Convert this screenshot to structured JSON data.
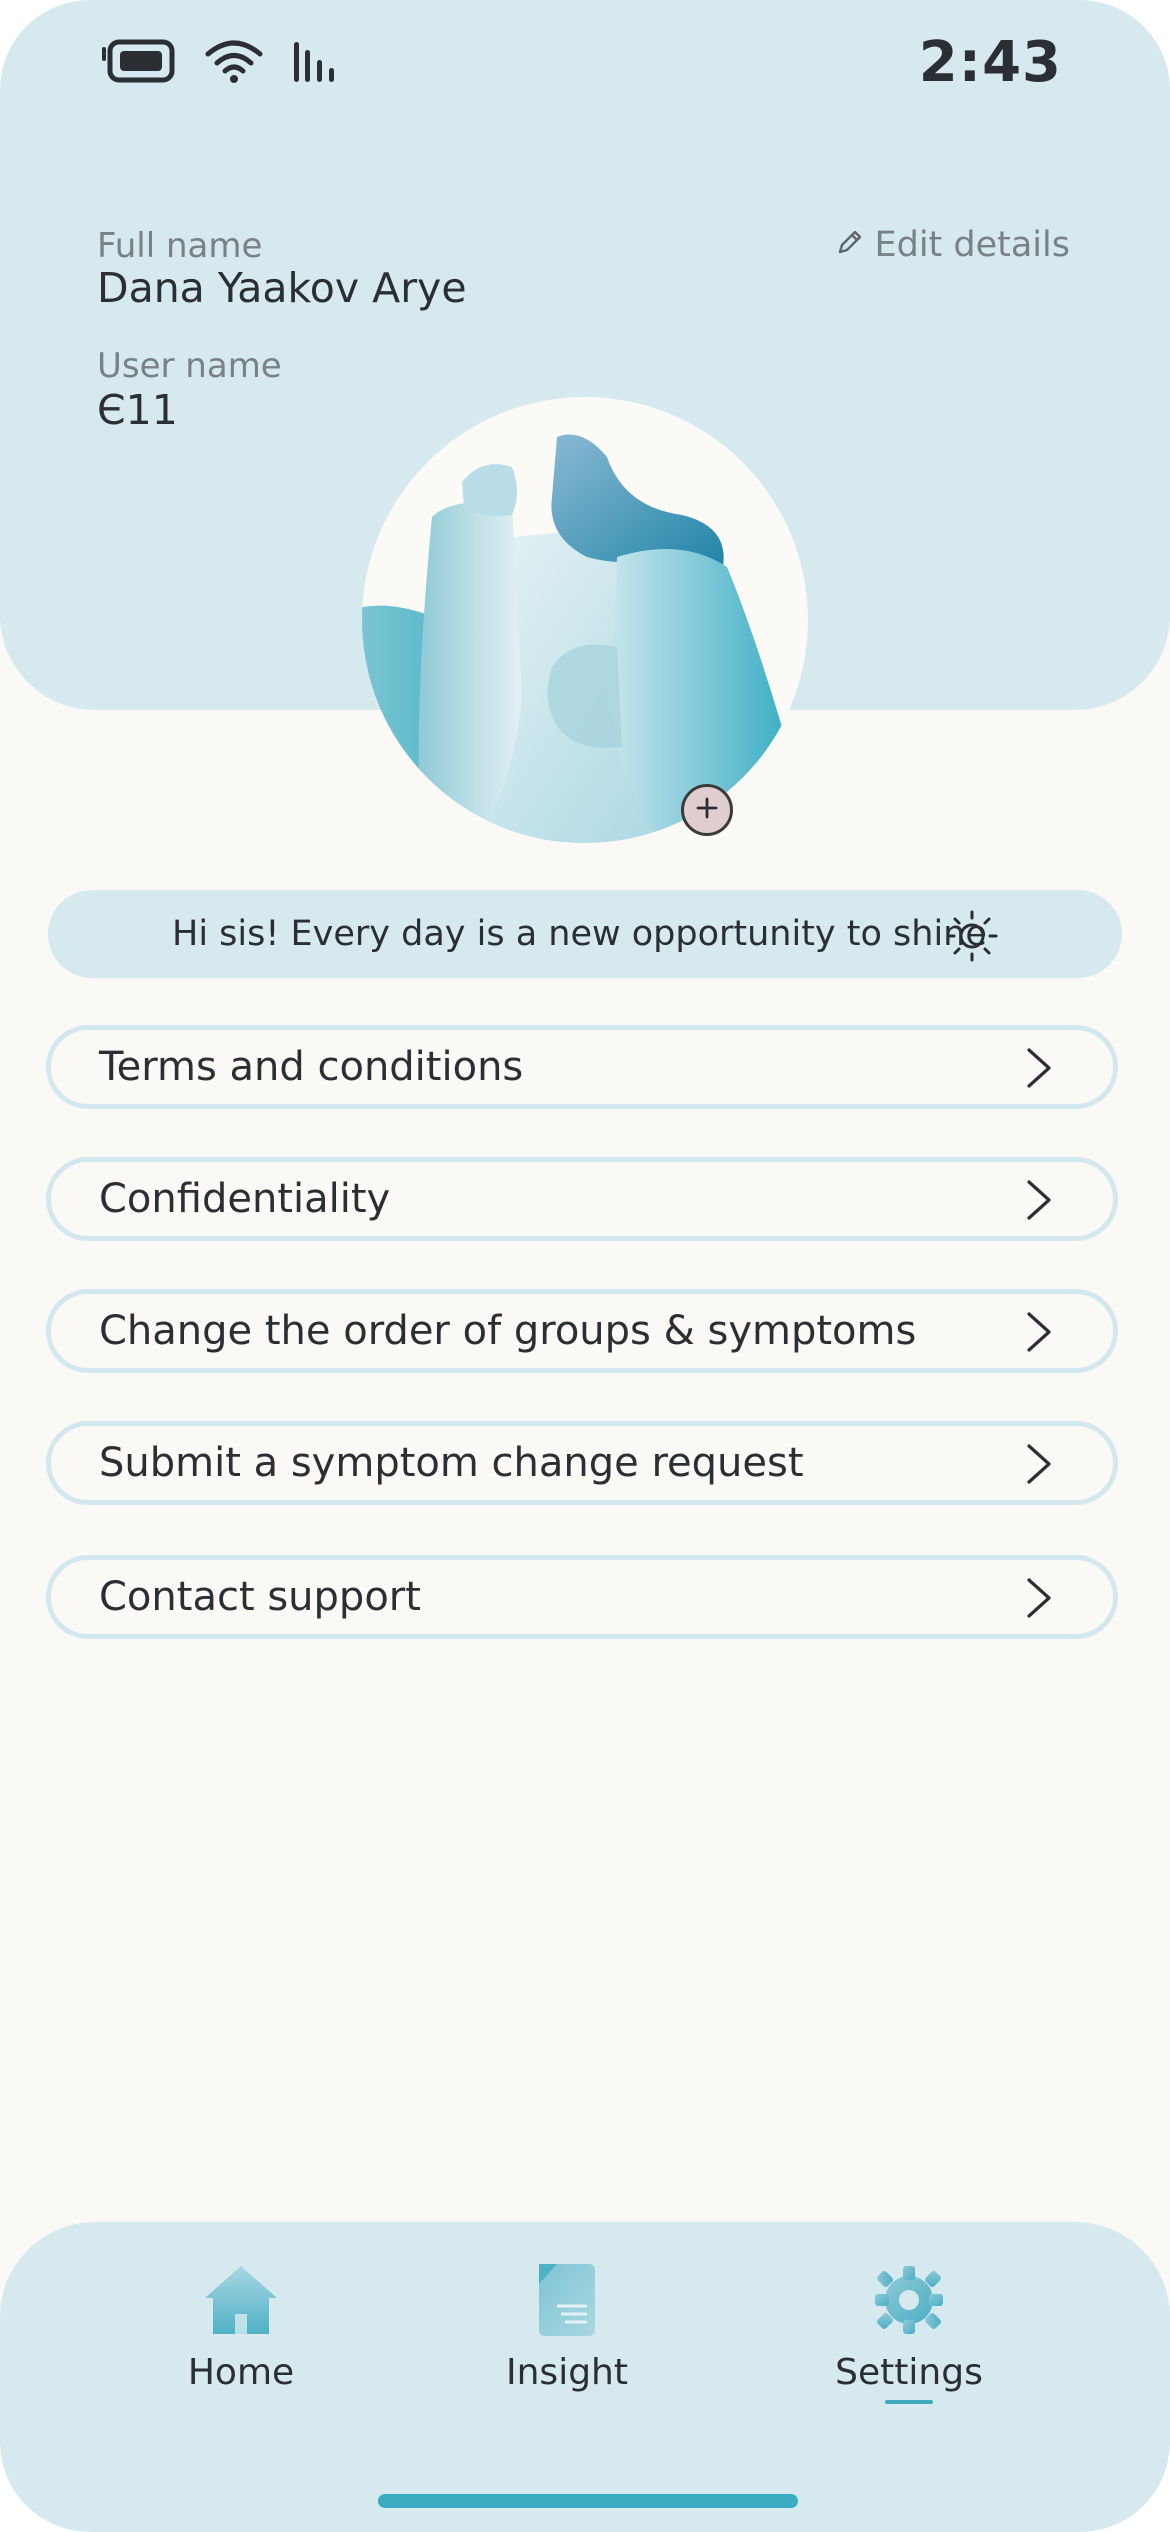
{
  "status_bar": {
    "time": "2:43",
    "icons": [
      "battery-icon",
      "wifi-icon",
      "signal-icon"
    ]
  },
  "profile": {
    "full_name_label": "Full name",
    "full_name": "Dana Yaakov Arye",
    "user_name_label": "User name",
    "user_name": "Є11",
    "edit_label": "Edit details",
    "avatar_add_icon": "plus-icon"
  },
  "greeting": {
    "text": "Hi sis! Every day is a new opportunity to shine",
    "icon": "sun-icon"
  },
  "menu": {
    "items": [
      {
        "label": "Terms and conditions"
      },
      {
        "label": "Confidentiality"
      },
      {
        "label": "Change the order of groups & symptoms"
      },
      {
        "label": "Submit a symptom change request"
      },
      {
        "label": "Contact support"
      }
    ]
  },
  "nav": {
    "active": "Settings",
    "items": [
      {
        "label": "Home",
        "icon": "home-icon"
      },
      {
        "label": "Insight",
        "icon": "insight-icon"
      },
      {
        "label": "Settings",
        "icon": "settings-icon"
      }
    ]
  },
  "colors": {
    "header_bg": "#d6e9ef",
    "page_bg": "#faf9f6",
    "accent": "#3aacc2",
    "text": "#2b2f33",
    "muted_text": "#7a8088"
  }
}
